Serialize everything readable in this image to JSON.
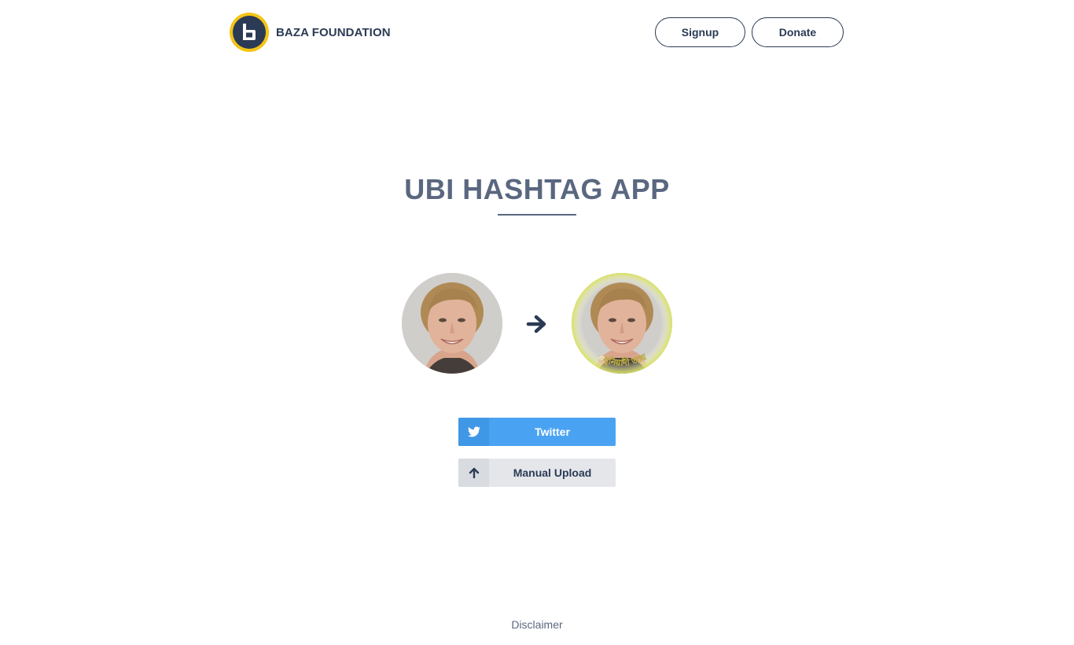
{
  "header": {
    "brand_name": "BAZA FOUNDATION",
    "logo_letter": "b",
    "signup_label": "Signup",
    "donate_label": "Donate"
  },
  "main": {
    "title": "UBI HASHTAG APP",
    "before_image_alt": "Original profile picture",
    "after_image_alt": "Profile picture with hashtag frame",
    "frame_text": "#বুনিয়াদী আয়",
    "buttons": {
      "twitter_label": "Twitter",
      "upload_label": "Manual Upload"
    }
  },
  "footer": {
    "disclaimer_label": "Disclaimer"
  },
  "icons": {
    "arrow": "arrow-right-icon",
    "twitter": "twitter-icon",
    "upload": "arrow-up-icon"
  },
  "colors": {
    "primary": "#2b3a55",
    "accent_yellow": "#f2c515",
    "title": "#5a6780",
    "twitter": "#4aa3f2",
    "upload_bg": "#e4e6ea"
  }
}
